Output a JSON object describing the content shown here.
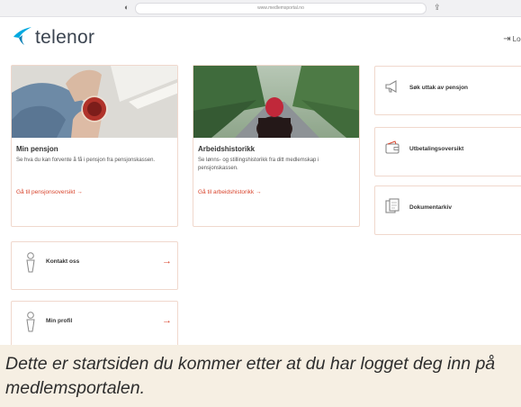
{
  "browser": {
    "url": "www.medlemsportal.no",
    "shield_icon": "shield-icon",
    "share_icon": "share-icon"
  },
  "header": {
    "brand": "telenor",
    "logout_label": "Log"
  },
  "cards": {
    "pension": {
      "title": "Min pensjon",
      "description": "Se hva du kan forvente å få i pensjon fra pensjonskassen.",
      "link": "Gå til pensjonsoversikt →"
    },
    "work_history": {
      "title": "Arbeidshistorikk",
      "description": "Se lønns- og stillingshistorikk fra ditt medlemskap i pensjonskassen.",
      "link": "Gå til arbeidshistorikk →"
    }
  },
  "side_cards": [
    {
      "label": "Søk uttak av pensjon",
      "icon": "megaphone-icon"
    },
    {
      "label": "Utbetalingsoversikt",
      "icon": "wallet-icon"
    },
    {
      "label": "Dokumentarkiv",
      "icon": "documents-icon"
    }
  ],
  "contact_cards": [
    {
      "label": "Kontakt oss",
      "icon": "person-icon",
      "arrow": "→"
    },
    {
      "label": "Min profil",
      "icon": "person-icon",
      "arrow": "→"
    }
  ],
  "caption": "Dette er startsiden du kommer etter at du har logget deg inn på medlemsportalen.",
  "colors": {
    "accent": "#d8442c",
    "brand_blue": "#00a9e0",
    "card_border": "#f0d8cd",
    "caption_bg": "#f6efe3"
  }
}
